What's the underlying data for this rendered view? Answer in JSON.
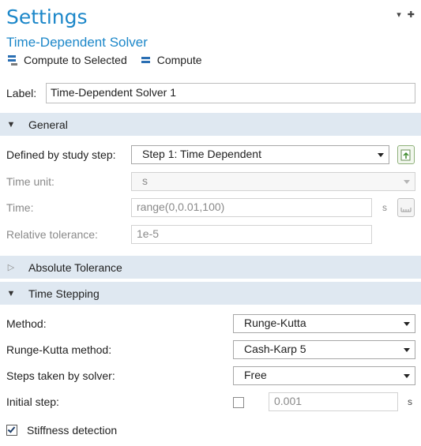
{
  "window": {
    "title": "Settings"
  },
  "top_icons": [
    {
      "name": "dropdown-arrow-icon",
      "glyph": "▾"
    },
    {
      "name": "pin-icon",
      "glyph": "✚"
    }
  ],
  "node": {
    "title": "Time-Dependent Solver"
  },
  "toolbar": {
    "compute_to_selected": "Compute to Selected",
    "compute": "Compute"
  },
  "label_field": {
    "label": "Label:",
    "value": "Time-Dependent Solver 1"
  },
  "sections": {
    "general": {
      "label": "General",
      "expanded": true
    },
    "absolute_tolerance": {
      "label": "Absolute Tolerance",
      "expanded": false
    },
    "time_stepping": {
      "label": "Time Stepping",
      "expanded": true
    }
  },
  "general": {
    "defined_by_study_step": {
      "label": "Defined by study step:",
      "value": "Step 1: Time Dependent"
    },
    "time_unit": {
      "label": "Time unit:",
      "value": "s"
    },
    "time": {
      "label": "Time:",
      "value": "range(0,0.01,100)",
      "unit": "s"
    },
    "relative_tolerance": {
      "label": "Relative tolerance:",
      "value": "1e-5"
    }
  },
  "time_stepping": {
    "method": {
      "label": "Method:",
      "value": "Runge-Kutta"
    },
    "rk_method": {
      "label": "Runge-Kutta method:",
      "value": "Cash-Karp 5"
    },
    "steps_taken": {
      "label": "Steps taken by solver:",
      "value": "Free"
    },
    "initial_step": {
      "label": "Initial step:",
      "value": "0.001",
      "unit": "s",
      "checked": false
    },
    "stiffness_detection": {
      "label": "Stiffness detection",
      "checked": true
    }
  },
  "colors": {
    "accent": "#1c87c9",
    "section_bg": "#dfe8f1",
    "disabled_text": "#8a8a8a"
  }
}
